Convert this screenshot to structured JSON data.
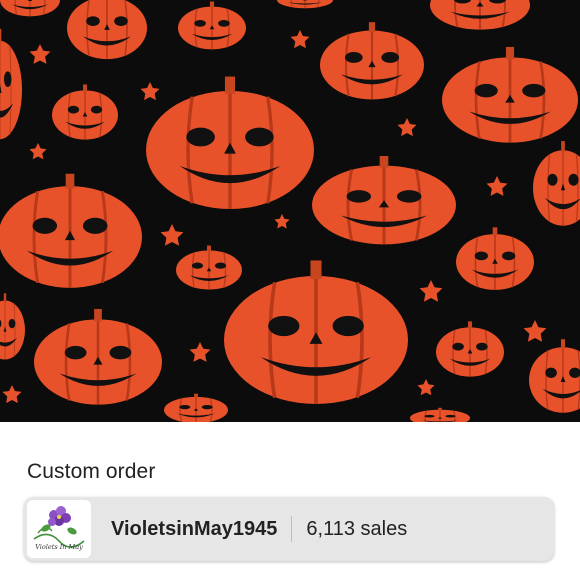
{
  "listing": {
    "image_icon": "jack-o-lantern-fabric-image",
    "title": "Custom order"
  },
  "shop": {
    "logo_text": "Violets In May",
    "name": "VioletsinMay1945",
    "sales": "6,113 sales"
  },
  "colors": {
    "pumpkin": "#e8522a",
    "background": "#0c0c0c",
    "card": "#e6e6e6"
  }
}
